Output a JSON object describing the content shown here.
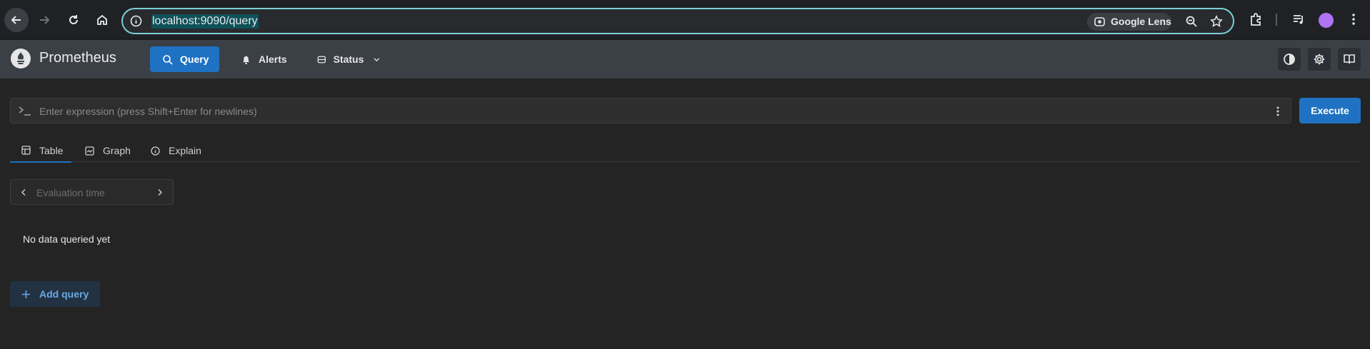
{
  "browser": {
    "url": "localhost:9090/query",
    "lens_label": "Google Lens"
  },
  "app": {
    "brand": "Prometheus",
    "nav": [
      {
        "label": "Query",
        "icon": "search-icon"
      },
      {
        "label": "Alerts",
        "icon": "bell-icon"
      },
      {
        "label": "Status",
        "icon": "server-icon"
      }
    ],
    "header_buttons": [
      "theme-toggle-icon",
      "gear-icon",
      "book-icon"
    ]
  },
  "query": {
    "placeholder": "Enter expression (press Shift+Enter for newlines)",
    "execute_label": "Execute",
    "tabs": [
      {
        "label": "Table",
        "icon": "table-icon",
        "active": true
      },
      {
        "label": "Graph",
        "icon": "graph-icon",
        "active": false
      },
      {
        "label": "Explain",
        "icon": "info-icon",
        "active": false
      }
    ],
    "eval_placeholder": "Evaluation time",
    "empty_message": "No data queried yet",
    "add_query_label": "Add query"
  },
  "colors": {
    "accent": "#1f72c2",
    "header_bg": "#3b4047",
    "page_bg": "#242424",
    "omnibox_border": "#7ccfd6",
    "avatar": "#b073f3"
  }
}
